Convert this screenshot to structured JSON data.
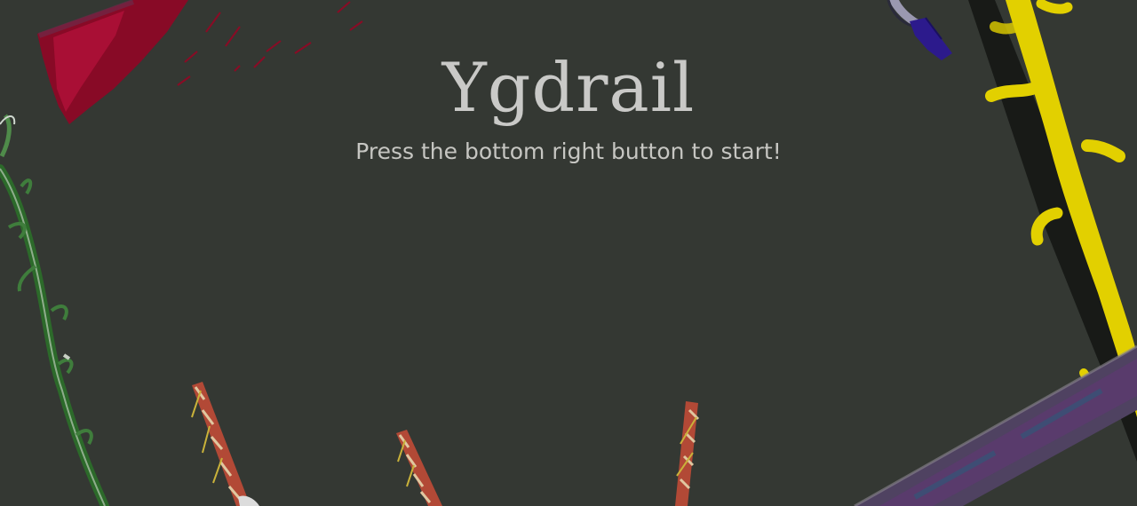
{
  "game": {
    "title": "Ygdrail",
    "subtitle": "Press the bottom right button to start!"
  },
  "colors": {
    "background": "#343833",
    "title_text": "#c9c9c7",
    "subtitle_text": "#c6c6c2",
    "crimson_banner": "#a0082a",
    "vine_green": "#2f6b2a",
    "yellow_vine": "#e6d300",
    "purple_beam": "#5b3f66",
    "striped_stake": "#b04a3a",
    "flask_blue": "#2b1b8a"
  },
  "decor": {
    "banner": "red-banner-art",
    "vine": "green-vine-art",
    "yellow_vine": "yellow-vine-art",
    "beam": "purple-beam-art",
    "stakes": [
      "striped-stake-left",
      "striped-stake-middle",
      "striped-stake-right"
    ],
    "flask": "blue-flask-art"
  }
}
